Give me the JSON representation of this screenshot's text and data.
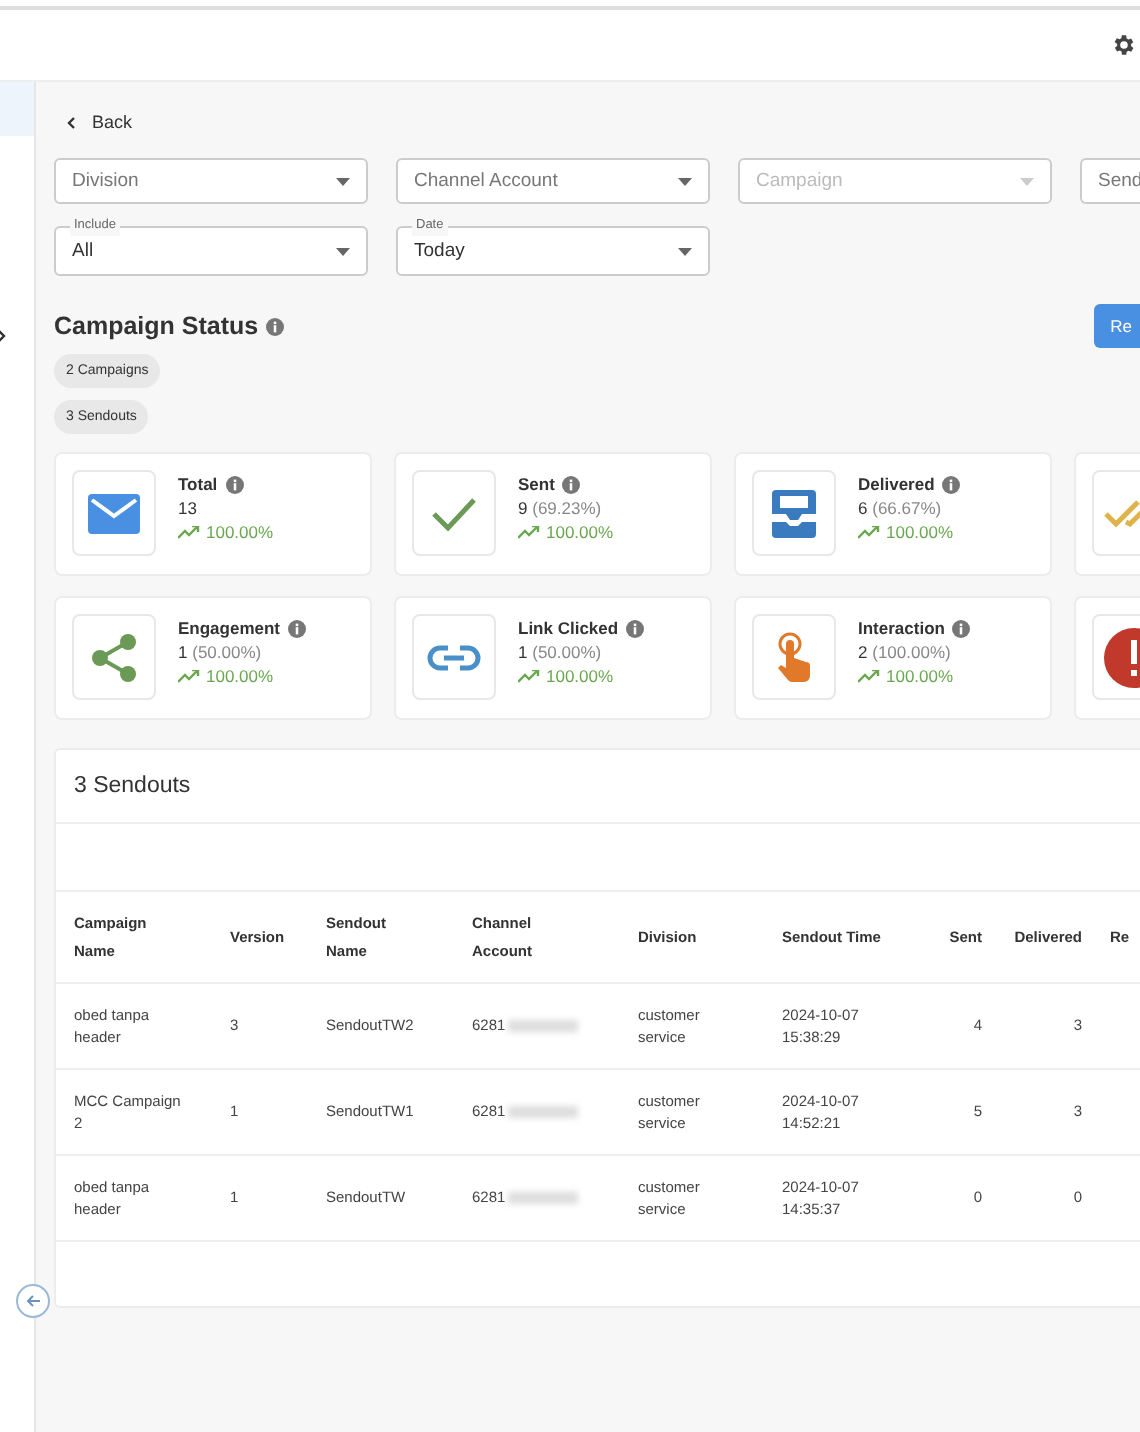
{
  "back": {
    "label": "Back"
  },
  "filters": [
    {
      "kind": "select",
      "placeholder": "Division",
      "disabled": false
    },
    {
      "kind": "select",
      "placeholder": "Channel Account",
      "disabled": false
    },
    {
      "kind": "select",
      "placeholder": "Campaign",
      "disabled": true
    },
    {
      "kind": "select",
      "placeholder": "Send",
      "disabled": false
    }
  ],
  "filters_row_2": [
    {
      "label": "Include",
      "value": "All"
    },
    {
      "label": "Date",
      "value": "Today"
    }
  ],
  "status": {
    "title": "Campaign Status",
    "chips": [
      "2 Campaigns",
      "3 Sendouts"
    ],
    "button": "Re"
  },
  "metrics": [
    {
      "kind": "total",
      "label": "Total",
      "value": "13",
      "trend": "100.00%"
    },
    {
      "kind": "sent",
      "label": "Sent",
      "value": "9",
      "share": "(69.23%)",
      "trend": "100.00%"
    },
    {
      "kind": "delivered",
      "label": "Delivered",
      "value": "6",
      "share": "(66.67%)",
      "trend": "100.00%"
    },
    {
      "kind": "read"
    },
    {
      "kind": "engagement",
      "label": "Engagement",
      "value": "1",
      "share": "(50.00%)",
      "trend": "100.00%"
    },
    {
      "kind": "link",
      "label": "Link Clicked",
      "value": "1",
      "share": "(50.00%)",
      "trend": "100.00%"
    },
    {
      "kind": "interaction",
      "label": "Interaction",
      "value": "2",
      "share": "(100.00%)",
      "trend": "100.00%"
    },
    {
      "kind": "failed"
    }
  ],
  "table": {
    "title": "3 Sendouts",
    "columns": [
      "Campaign Name",
      "Version",
      "Sendout Name",
      "Channel Account",
      "Division",
      "Sendout Time",
      "Sent",
      "Delivered",
      "Re"
    ],
    "rows": [
      {
        "campaign": "obed tanpa header",
        "version": "3",
        "sendout": "SendoutTW2",
        "account": "6281",
        "redacted": true,
        "division": "customer service",
        "time": "2024-10-07 15:38:29",
        "sent": "4",
        "delivered": "3"
      },
      {
        "campaign": "MCC Campaign 2",
        "version": "1",
        "sendout": "SendoutTW1",
        "account": "6281",
        "redacted": true,
        "division": "customer service",
        "time": "2024-10-07 14:52:21",
        "sent": "5",
        "delivered": "3"
      },
      {
        "campaign": "obed tanpa header",
        "version": "1",
        "sendout": "SendoutTW",
        "account": "6281",
        "redacted": true,
        "division": "customer service",
        "time": "2024-10-07 14:35:37",
        "sent": "0",
        "delivered": "0"
      }
    ]
  }
}
